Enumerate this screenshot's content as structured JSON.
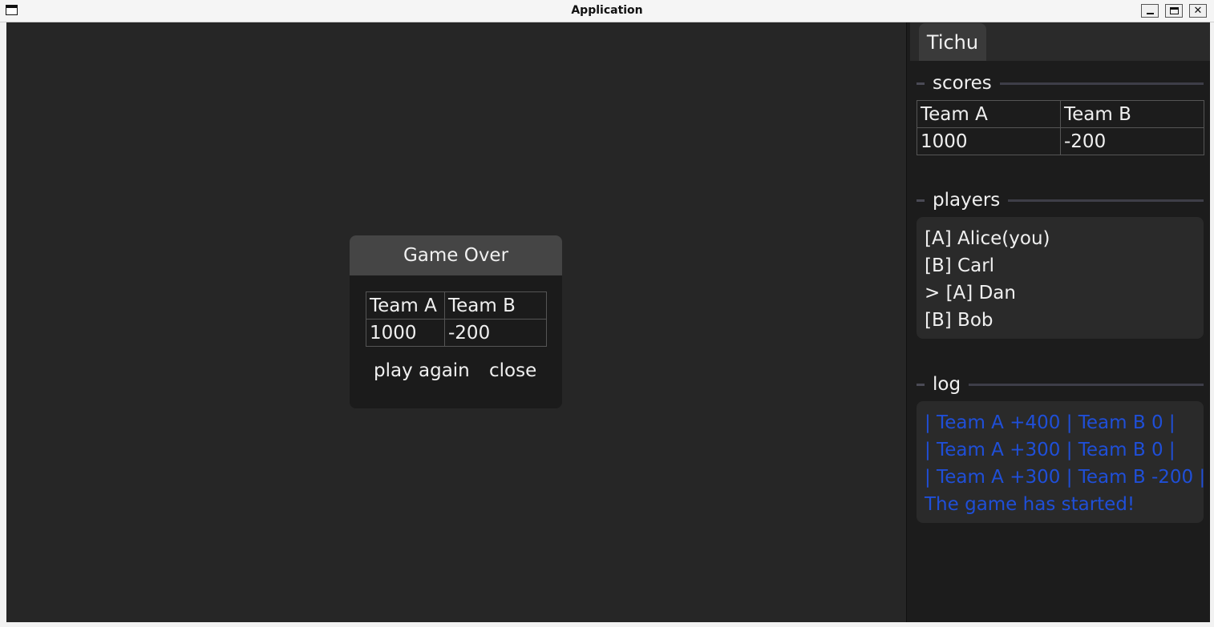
{
  "window": {
    "title": "Application"
  },
  "sidebar": {
    "tab_label": "Tichu",
    "scores": {
      "heading": "scores",
      "headers": [
        "Team A",
        "Team B"
      ],
      "values": [
        "1000",
        "-200"
      ]
    },
    "players": {
      "heading": "players",
      "items": [
        "[A] Alice(you)",
        "[B] Carl",
        "> [A] Dan",
        "[B] Bob"
      ]
    },
    "log": {
      "heading": "log",
      "entries": [
        "| Team A +400 | Team B 0 |",
        "| Team A +300 | Team B 0 |",
        "| Team A +300 | Team B -200 |",
        "The game has started!"
      ],
      "text_color": "#1f4fd8"
    }
  },
  "dialog": {
    "title": "Game Over",
    "headers": [
      "Team A",
      "Team B"
    ],
    "values": [
      "1000",
      "-200"
    ],
    "play_again_label": "play again",
    "close_label": "close"
  },
  "colors": {
    "canvas_bg": "#262626",
    "sidebar_bg": "#1c1c1c",
    "panel_bg": "#2a2a2a",
    "dialog_header_bg": "#454545"
  }
}
